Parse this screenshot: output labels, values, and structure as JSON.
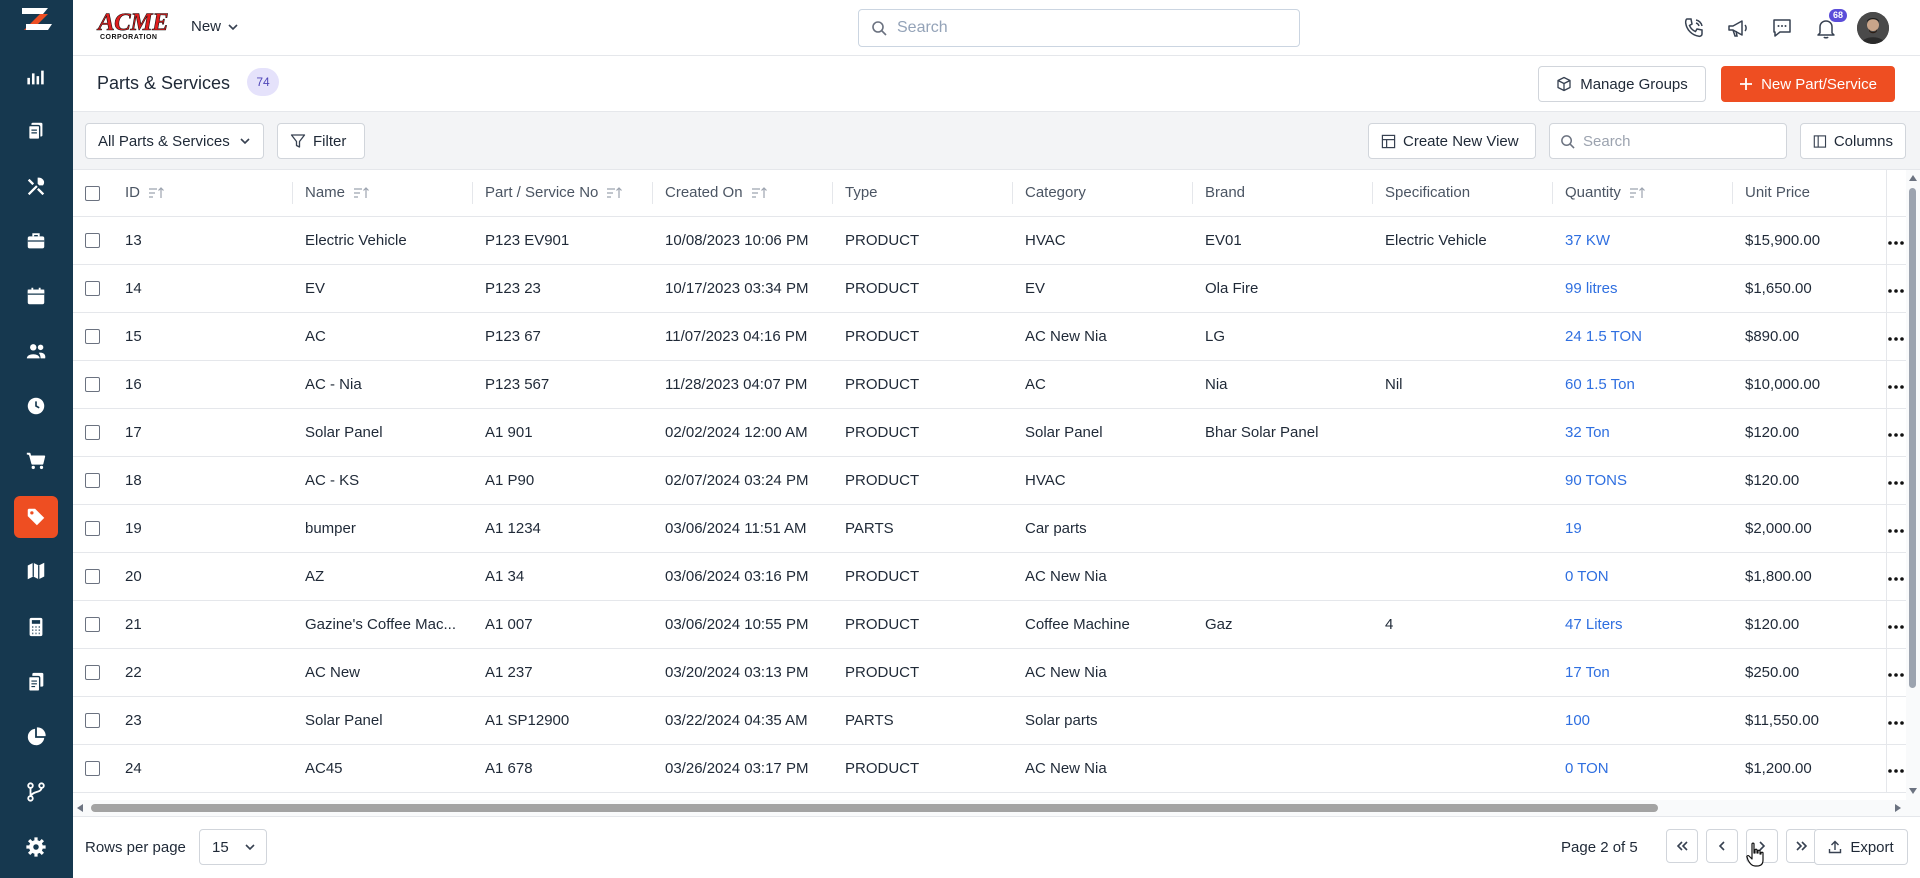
{
  "app": {
    "brand_logo_text": "ACME",
    "brand_logo_subtext": "CORPORATION",
    "new_menu_label": "New",
    "search_placeholder": "Search",
    "notification_count": "68"
  },
  "sidebar": {
    "items": [
      {
        "icon": "dashboard-chart-icon",
        "active": false
      },
      {
        "icon": "documents-icon",
        "active": false
      },
      {
        "icon": "tools-icon",
        "active": false
      },
      {
        "icon": "briefcase-icon",
        "active": false
      },
      {
        "icon": "calendar-icon",
        "active": false
      },
      {
        "icon": "users-icon",
        "active": false
      },
      {
        "icon": "clock-icon",
        "active": false
      },
      {
        "icon": "cart-icon",
        "active": false
      },
      {
        "icon": "tag-icon",
        "active": true
      },
      {
        "icon": "map-icon",
        "active": false
      },
      {
        "icon": "calculator-icon",
        "active": false
      },
      {
        "icon": "files-icon",
        "active": false
      },
      {
        "icon": "pie-chart-icon",
        "active": false
      },
      {
        "icon": "workflow-icon",
        "active": false
      },
      {
        "icon": "settings-icon",
        "active": false
      }
    ],
    "accent_color": "#ee4e22",
    "background_color": "#16384f"
  },
  "page": {
    "title": "Parts & Services",
    "count": "74",
    "manage_groups_label": "Manage Groups",
    "new_button_label": "New Part/Service"
  },
  "toolbar": {
    "view_select": "All Parts & Services",
    "filter_label": "Filter",
    "create_view_label": "Create New View",
    "search_placeholder": "Search",
    "columns_label": "Columns"
  },
  "table": {
    "columns": [
      "ID",
      "Name",
      "Part / Service No",
      "Created On",
      "Type",
      "Category",
      "Brand",
      "Specification",
      "Quantity",
      "Unit Price"
    ],
    "rows": [
      {
        "id": "13",
        "name": "Electric Vehicle",
        "part_no": "P123 EV901",
        "created": "10/08/2023 10:06 PM",
        "type": "PRODUCT",
        "category": "HVAC",
        "brand": "EV01",
        "spec": "Electric Vehicle",
        "qty": "37 KW",
        "price": "$15,900.00"
      },
      {
        "id": "14",
        "name": "EV",
        "part_no": "P123 23",
        "created": "10/17/2023 03:34 PM",
        "type": "PRODUCT",
        "category": "EV",
        "brand": "Ola Fire",
        "spec": "",
        "qty": "99 litres",
        "price": "$1,650.00"
      },
      {
        "id": "15",
        "name": "AC",
        "part_no": "P123 67",
        "created": "11/07/2023 04:16 PM",
        "type": "PRODUCT",
        "category": "AC New Nia",
        "brand": "LG",
        "spec": "",
        "qty": "24 1.5 TON",
        "price": "$890.00"
      },
      {
        "id": "16",
        "name": "AC - Nia",
        "part_no": "P123 567",
        "created": "11/28/2023 04:07 PM",
        "type": "PRODUCT",
        "category": "AC",
        "brand": "Nia",
        "spec": "Nil",
        "qty": "60 1.5 Ton",
        "price": "$10,000.00"
      },
      {
        "id": "17",
        "name": "Solar Panel",
        "part_no": "A1 901",
        "created": "02/02/2024 12:00 AM",
        "type": "PRODUCT",
        "category": "Solar Panel",
        "brand": "Bhar Solar Panel",
        "spec": "",
        "qty": "32 Ton",
        "price": "$120.00"
      },
      {
        "id": "18",
        "name": "AC - KS",
        "part_no": "A1 P90",
        "created": "02/07/2024 03:24 PM",
        "type": "PRODUCT",
        "category": "HVAC",
        "brand": "",
        "spec": "",
        "qty": "90 TONS",
        "price": "$120.00"
      },
      {
        "id": "19",
        "name": "bumper",
        "part_no": "A1 1234",
        "created": "03/06/2024 11:51 AM",
        "type": "PARTS",
        "category": "Car parts",
        "brand": "",
        "spec": "",
        "qty": "19",
        "price": "$2,000.00"
      },
      {
        "id": "20",
        "name": "AZ",
        "part_no": "A1 34",
        "created": "03/06/2024 03:16 PM",
        "type": "PRODUCT",
        "category": "AC New Nia",
        "brand": "",
        "spec": "",
        "qty": "0 TON",
        "price": "$1,800.00"
      },
      {
        "id": "21",
        "name": "Gazine's Coffee Mac...",
        "part_no": "A1 007",
        "created": "03/06/2024 10:55 PM",
        "type": "PRODUCT",
        "category": "Coffee Machine",
        "brand": "Gaz",
        "spec": "4",
        "qty": "47 Liters",
        "price": "$120.00"
      },
      {
        "id": "22",
        "name": "AC New",
        "part_no": "A1 237",
        "created": "03/20/2024 03:13 PM",
        "type": "PRODUCT",
        "category": "AC New Nia",
        "brand": "",
        "spec": "",
        "qty": "17 Ton",
        "price": "$250.00"
      },
      {
        "id": "23",
        "name": "Solar Panel",
        "part_no": "A1 SP12900",
        "created": "03/22/2024 04:35 AM",
        "type": "PARTS",
        "category": "Solar parts",
        "brand": "",
        "spec": "",
        "qty": "100",
        "price": "$11,550.00"
      },
      {
        "id": "24",
        "name": "AC45",
        "part_no": "A1 678",
        "created": "03/26/2024 03:17 PM",
        "type": "PRODUCT",
        "category": "AC New Nia",
        "brand": "",
        "spec": "",
        "qty": "0 TON",
        "price": "$1,200.00"
      }
    ],
    "link_color": "#2f6fe0"
  },
  "footer": {
    "rows_per_page_label": "Rows per page",
    "rows_per_page_value": "15",
    "page_info": "Page 2 of 5",
    "export_label": "Export"
  }
}
